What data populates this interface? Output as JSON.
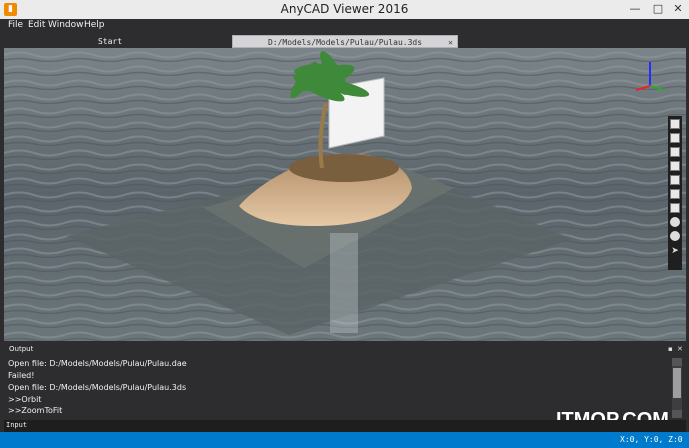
{
  "window": {
    "title": "AnyCAD Viewer 2016",
    "min": "—",
    "max": "□",
    "close": "✕"
  },
  "menu": {
    "items": [
      "File",
      "Edit",
      "Window",
      "Help"
    ]
  },
  "tabs": {
    "start": "Start",
    "file": "D:/Models/Models/Pulau/Pulau.3ds",
    "close": "✕"
  },
  "output": {
    "title": "Output",
    "pin": "▪",
    "close": "✕",
    "lines": [
      "Open file: D:/Models/Models/Pulau/Pulau.dae",
      "Failed!",
      "Open file: D:/Models/Models/Pulau/Pulau.3ds",
      ">>Orbit",
      ">>ZoomToFit"
    ]
  },
  "input": {
    "label": "Input",
    "value": ""
  },
  "status": {
    "coords": "X:0, Y:0, Z:0"
  },
  "watermark": "ITMOP.COM",
  "colors": {
    "accent": "#007acc",
    "app_icon": "#f08a00",
    "chrome": "#2d2d30"
  }
}
